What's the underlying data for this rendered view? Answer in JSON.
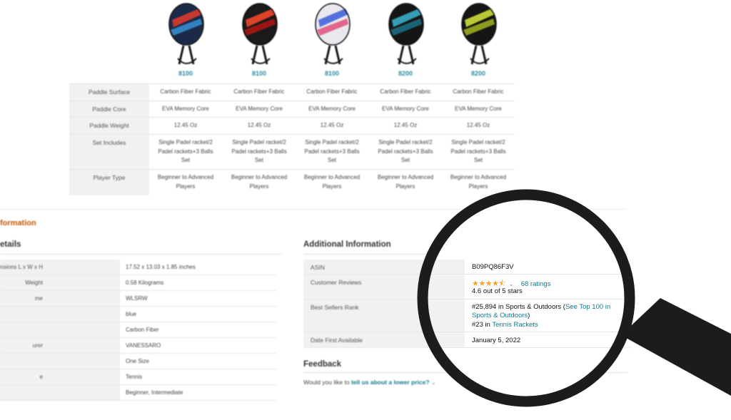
{
  "comparison": {
    "paddles": [
      {
        "model": "8100",
        "colors": [
          "#1c2a4a",
          "#e63b2a",
          "#3aa0e8"
        ]
      },
      {
        "model": "8100",
        "colors": [
          "#1a1a1a",
          "#ff4a2a",
          "#c91515"
        ]
      },
      {
        "model": "8100",
        "colors": [
          "#e8e8ee",
          "#3a5ad8",
          "#e03a6a"
        ]
      },
      {
        "model": "8200",
        "colors": [
          "#151515",
          "#38b6d0",
          "#1c7f95"
        ]
      },
      {
        "model": "8200",
        "colors": [
          "#151515",
          "#d9e83a",
          "#b8c822"
        ]
      }
    ],
    "rows": [
      {
        "label": "Paddle Surface",
        "values": [
          "Carbon Fiber Fabric",
          "Carbon Fiber Fabric",
          "Carbon Fiber Fabric",
          "Carbon Fiber Fabric",
          "Carbon Fiber Fabric"
        ]
      },
      {
        "label": "Paddle Core",
        "values": [
          "EVA Memory Core",
          "EVA Memory Core",
          "EVA Memory Core",
          "EVA Memory Core",
          "EVA Memory Core"
        ]
      },
      {
        "label": "Paddle Weight",
        "values": [
          "12.45 Oz",
          "12.45 Oz",
          "12.45 Oz",
          "12.45 Oz",
          "12.45 Oz"
        ]
      },
      {
        "label": "Set Includes",
        "values": [
          "Single Padel racket/2 Padel rackets+3 Balls Set",
          "Single Padel racket/2 Padel rackets+3 Balls Set",
          "Single Padel racket/2 Padel rackets+3 Balls Set",
          "Single Padel racket/2 Padel rackets+3 Balls Set",
          "Single Padel racket/2 Padel rackets+3 Balls Set"
        ]
      },
      {
        "label": "Player Type",
        "values": [
          "Beginner to Advanced Players",
          "Beginner to Advanced Players",
          "Beginner to Advanced Players",
          "Beginner to Advanced Players",
          "Beginner to Advanced Players"
        ]
      }
    ]
  },
  "product_info": {
    "heading": "formation",
    "details_heading": "etails",
    "details": [
      {
        "label": "age Dimensions L x W x H",
        "value": "17.52 x 13.03 x 1.85 inches"
      },
      {
        "label": "Weight",
        "value": "0.58 Kilograms"
      },
      {
        "label": "me",
        "value": "WLSRW"
      },
      {
        "label": "",
        "value": "blue"
      },
      {
        "label": "",
        "value": "Carbon Fiber"
      },
      {
        "label": "urer",
        "value": "VANESSARO"
      },
      {
        "label": "",
        "value": "One Size"
      },
      {
        "label": "e",
        "value": "Tennis"
      },
      {
        "label": "",
        "value": "Beginner, Intermediate"
      }
    ]
  },
  "additional": {
    "heading": "Additional Information",
    "asin_label": "ASIN",
    "asin": "B09PQ86F3V",
    "reviews_label": "Customer Reviews",
    "stars": "★★★★⯪",
    "rating_value": 4.6,
    "chevron": "⌄",
    "ratings_count": "68 ratings",
    "rating_text": "4.6 out of 5 stars",
    "rank_label": "Best Sellers Rank",
    "rank1": "#25,894 in Sports & Outdoors (",
    "rank1_link": "See Top 100 in",
    "rank1_link2": "Sports & Outdoors",
    "rank1_close": ")",
    "rank2": "#23 in ",
    "rank2_link": "Tennis Rackets",
    "date_label": "Date First Available",
    "date": "January 5, 2022"
  },
  "feedback": {
    "heading": "Feedback",
    "prompt": "Would you like to ",
    "link": "tell us about a lower price?",
    "chevron": "⌄"
  },
  "magnifier": {
    "frame_color": "#1c1c1c"
  }
}
